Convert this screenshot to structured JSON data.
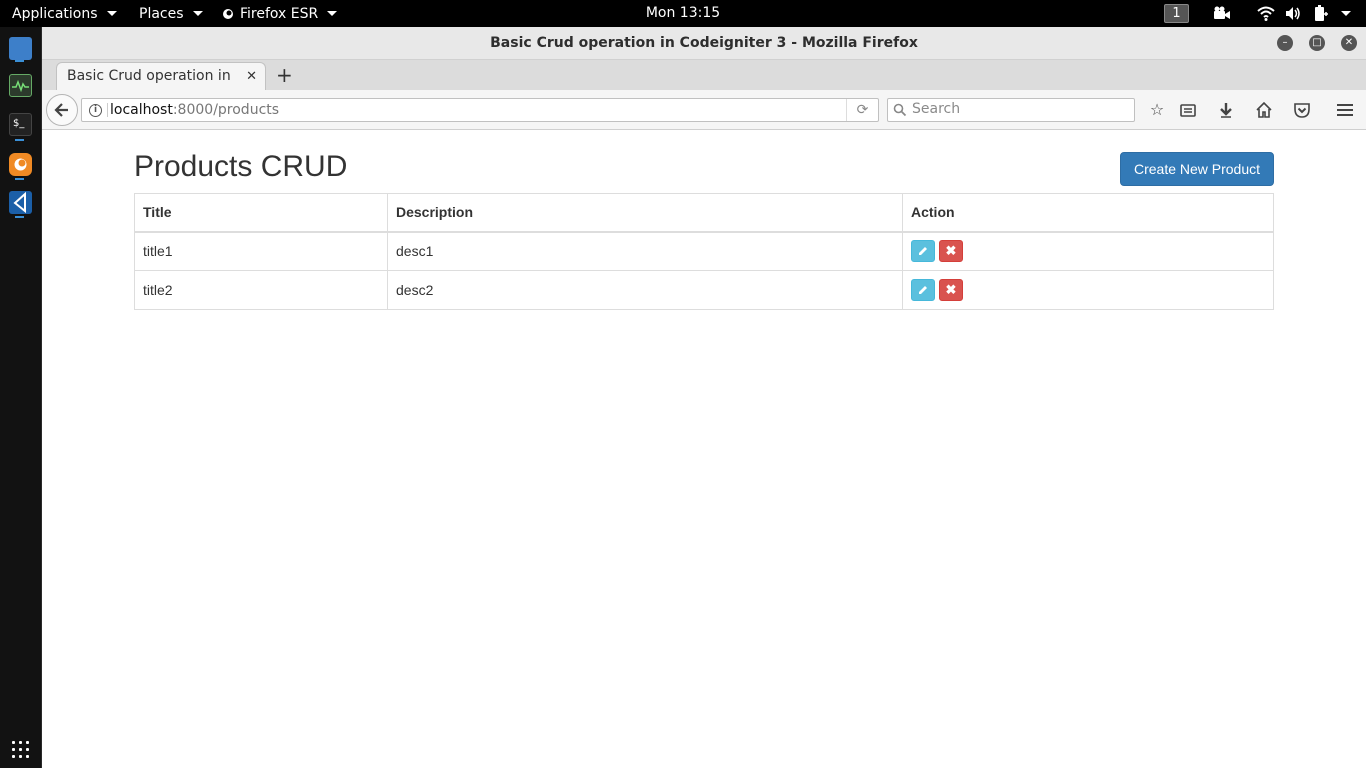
{
  "top_panel": {
    "applications_label": "Applications",
    "places_label": "Places",
    "firefox_label": "Firefox ESR",
    "clock": "Mon 13:15",
    "workspace": "1"
  },
  "window": {
    "title": "Basic Crud operation in Codeigniter 3 - Mozilla Firefox"
  },
  "tabs": [
    {
      "label": "Basic Crud operation in ..."
    }
  ],
  "navbar": {
    "url_host": "localhost",
    "url_path": ":8000/products",
    "search_placeholder": "Search"
  },
  "page": {
    "title": "Products CRUD",
    "create_button": "Create New Product",
    "table": {
      "headers": [
        "Title",
        "Description",
        "Action"
      ],
      "rows": [
        {
          "title": "title1",
          "description": "desc1"
        },
        {
          "title": "title2",
          "description": "desc2"
        }
      ]
    }
  },
  "colors": {
    "primary": "#337ab7",
    "info": "#5bc0de",
    "danger": "#d9534f"
  }
}
